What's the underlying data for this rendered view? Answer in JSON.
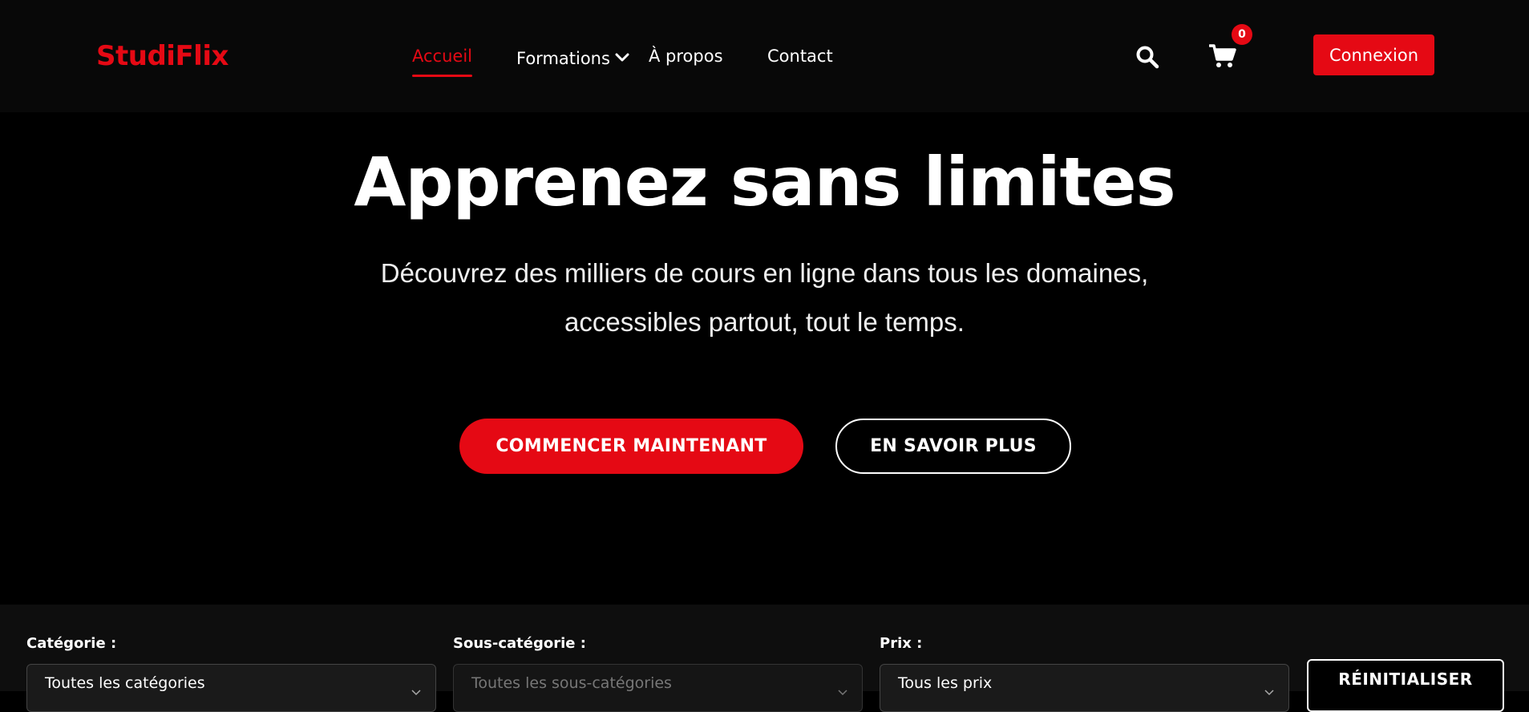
{
  "brand": {
    "name": "StudiFlix",
    "accent_color": "#e50914"
  },
  "nav": {
    "items": [
      {
        "label": "Accueil",
        "active": true
      },
      {
        "label": "Formations",
        "has_dropdown": true
      },
      {
        "label": "À propos"
      },
      {
        "label": "Contact"
      }
    ],
    "search_icon": "search-icon",
    "cart_icon": "cart-icon",
    "cart_count": "0",
    "login_label": "Connexion"
  },
  "hero": {
    "title": "Apprenez sans limites",
    "subtitle_line1": "Découvrez des milliers de cours en ligne dans tous les domaines,",
    "subtitle_line2": "accessibles partout, tout le temps.",
    "primary_cta": "COMMENCER MAINTENANT",
    "secondary_cta": "EN SAVOIR PLUS"
  },
  "filters": {
    "category": {
      "label": "Catégorie :",
      "selected": "Toutes les catégories"
    },
    "subcategory": {
      "label": "Sous-catégorie :",
      "selected": "Toutes les sous-catégories"
    },
    "price": {
      "label": "Prix :",
      "selected": "Tous les prix"
    },
    "reset_label": "RÉINITIALISER"
  }
}
